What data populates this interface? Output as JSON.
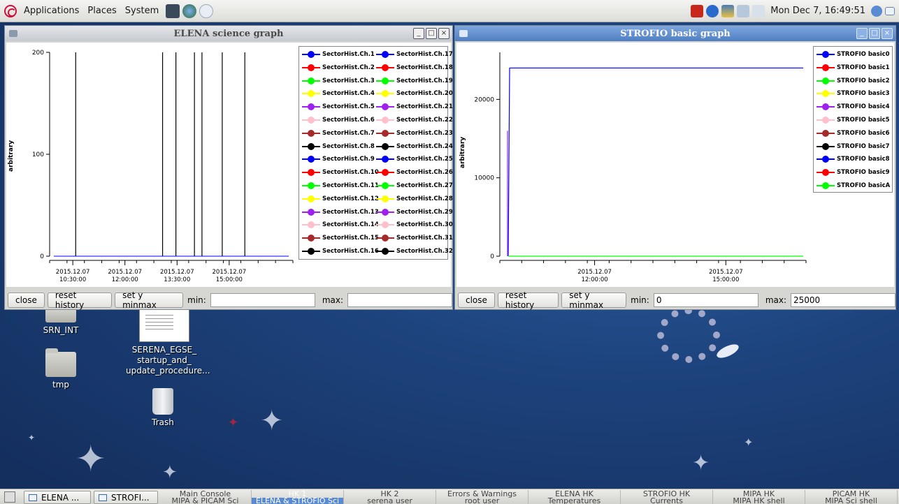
{
  "top_panel": {
    "menus": [
      "Applications",
      "Places",
      "System"
    ],
    "clock": "Mon Dec  7, 16:49:51"
  },
  "elena_window": {
    "title": "ELENA science graph",
    "ylabel": "arbitrary",
    "legend": [
      {
        "label": "SectorHist.Ch.1",
        "color": "#0000ff"
      },
      {
        "label": "SectorHist.Ch.2",
        "color": "#ff0000"
      },
      {
        "label": "SectorHist.Ch.3",
        "color": "#00ff00"
      },
      {
        "label": "SectorHist.Ch.4",
        "color": "#ffff00"
      },
      {
        "label": "SectorHist.Ch.5",
        "color": "#a020f0"
      },
      {
        "label": "SectorHist.Ch.6",
        "color": "#ffc0cb"
      },
      {
        "label": "SectorHist.Ch.7",
        "color": "#a52a2a"
      },
      {
        "label": "SectorHist.Ch.8",
        "color": "#000000"
      },
      {
        "label": "SectorHist.Ch.9",
        "color": "#0000ff"
      },
      {
        "label": "SectorHist.Ch.10",
        "color": "#ff0000"
      },
      {
        "label": "SectorHist.Ch.11",
        "color": "#00ff00"
      },
      {
        "label": "SectorHist.Ch.12",
        "color": "#ffff00"
      },
      {
        "label": "SectorHist.Ch.13",
        "color": "#a020f0"
      },
      {
        "label": "SectorHist.Ch.14",
        "color": "#ffc0cb"
      },
      {
        "label": "SectorHist.Ch.15",
        "color": "#a52a2a"
      },
      {
        "label": "SectorHist.Ch.16",
        "color": "#000000"
      },
      {
        "label": "SectorHist.Ch.17",
        "color": "#0000ff"
      },
      {
        "label": "SectorHist.Ch.18",
        "color": "#ff0000"
      },
      {
        "label": "SectorHist.Ch.19",
        "color": "#00ff00"
      },
      {
        "label": "SectorHist.Ch.20",
        "color": "#ffff00"
      },
      {
        "label": "SectorHist.Ch.21",
        "color": "#a020f0"
      },
      {
        "label": "SectorHist.Ch.22",
        "color": "#ffc0cb"
      },
      {
        "label": "SectorHist.Ch.23",
        "color": "#a52a2a"
      },
      {
        "label": "SectorHist.Ch.24",
        "color": "#000000"
      },
      {
        "label": "SectorHist.Ch.25",
        "color": "#0000ff"
      },
      {
        "label": "SectorHist.Ch.26",
        "color": "#ff0000"
      },
      {
        "label": "SectorHist.Ch.27",
        "color": "#00ff00"
      },
      {
        "label": "SectorHist.Ch.28",
        "color": "#ffff00"
      },
      {
        "label": "SectorHist.Ch.29",
        "color": "#a020f0"
      },
      {
        "label": "SectorHist.Ch.30",
        "color": "#ffc0cb"
      },
      {
        "label": "SectorHist.Ch.31",
        "color": "#a52a2a"
      },
      {
        "label": "SectorHist.Ch.32",
        "color": "#000000"
      }
    ],
    "close_label": "close",
    "reset_label": "reset history",
    "setminmax_label": "set y minmax",
    "min_label": "min:",
    "max_label": "max:",
    "min_value": "",
    "max_value": ""
  },
  "strofio_window": {
    "title": "STROFIO basic graph",
    "ylabel": "arbitrary",
    "legend": [
      {
        "label": "STROFIO basic0",
        "color": "#0000ff"
      },
      {
        "label": "STROFIO basic1",
        "color": "#ff0000"
      },
      {
        "label": "STROFIO basic2",
        "color": "#00ff00"
      },
      {
        "label": "STROFIO basic3",
        "color": "#ffff00"
      },
      {
        "label": "STROFIO basic4",
        "color": "#a020f0"
      },
      {
        "label": "STROFIO basic5",
        "color": "#ffc0cb"
      },
      {
        "label": "STROFIO basic6",
        "color": "#a52a2a"
      },
      {
        "label": "STROFIO basic7",
        "color": "#000000"
      },
      {
        "label": "STROFIO basic8",
        "color": "#0000ff"
      },
      {
        "label": "STROFIO basic9",
        "color": "#ff0000"
      },
      {
        "label": "STROFIO basicA",
        "color": "#00ff00"
      }
    ],
    "close_label": "close",
    "reset_label": "reset history",
    "setminmax_label": "set y minmax",
    "min_label": "min:",
    "max_label": "max:",
    "min_value": "0",
    "max_value": "25000"
  },
  "chart_data": [
    {
      "type": "line",
      "ylim": [
        0,
        200
      ],
      "yticks": [
        0,
        100,
        200
      ],
      "xlim": [
        "2015.12.07 09:50:00",
        "2015.12.07 16:50:00"
      ],
      "xticks": [
        "2015.12.07 10:30:00",
        "2015.12.07 12:00:00",
        "2015.12.07 13:30:00",
        "2015.12.07 15:00:00"
      ],
      "series": [
        {
          "name": "SectorHist.Ch.8",
          "color": "#000000",
          "spikes": [
            {
              "x": "2015.12.07 10:35:00",
              "y": 200
            },
            {
              "x": "2015.12.07 13:05:00",
              "y": 200
            },
            {
              "x": "2015.12.07 13:28:00",
              "y": 200
            },
            {
              "x": "2015.12.07 14:00:00",
              "y": 200
            },
            {
              "x": "2015.12.07 14:13:00",
              "y": 200
            },
            {
              "x": "2015.12.07 14:48:00",
              "y": 200
            },
            {
              "x": "2015.12.07 15:27:00",
              "y": 200
            }
          ]
        },
        {
          "name": "SectorHist.Ch.1",
          "color": "#0000ff",
          "baseline": 0
        }
      ]
    },
    {
      "type": "line",
      "ylim": [
        0,
        26000
      ],
      "yticks": [
        0,
        10000,
        20000
      ],
      "xlim": [
        "2015.12.07 09:50:00",
        "2015.12.07 16:50:00"
      ],
      "xticks": [
        "2015.12.07 12:00:00",
        "2015.12.07 15:00:00"
      ],
      "series": [
        {
          "name": "STROFIO basic0",
          "color": "#0000ff",
          "value": 24000
        },
        {
          "name": "STROFIO basic4",
          "color": "#a020f0",
          "spike": 16000
        },
        {
          "name": "STROFIO basicA",
          "color": "#00ff00",
          "value": 0
        }
      ]
    }
  ],
  "desktop_icons": [
    {
      "label": "SRN_INT"
    },
    {
      "label": "SERENA_EGSE_ startup_and_ update_procedure..."
    },
    {
      "label": "tmp"
    },
    {
      "label": "Trash"
    }
  ],
  "taskbar": {
    "tasks": [
      "ELENA ...",
      "STROFI..."
    ],
    "workspaces": [
      {
        "name": "Main Console",
        "sub": "MIPA & PICAM Sci"
      },
      {
        "name": "HK 1",
        "sub": "ELENA & STROFIO Sci"
      },
      {
        "name": "HK 2",
        "sub": "serena user"
      },
      {
        "name": "Errors & Warnings",
        "sub": "root user"
      },
      {
        "name": "ELENA HK",
        "sub": "Temperatures"
      },
      {
        "name": "STROFIO HK",
        "sub": "Currents"
      },
      {
        "name": "MIPA HK",
        "sub": "MIPA HK shell"
      },
      {
        "name": "PICAM HK",
        "sub": "MIPA Sci shell"
      }
    ]
  }
}
